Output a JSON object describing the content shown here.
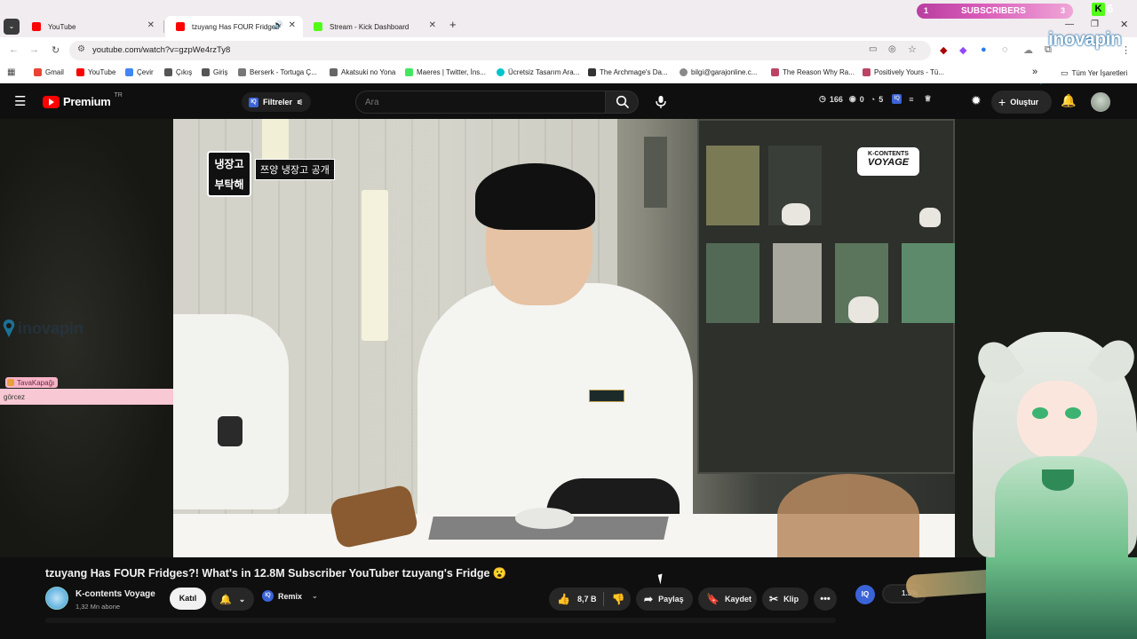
{
  "browser": {
    "tabs": [
      {
        "title": "YouTube",
        "active": false
      },
      {
        "title": "tzuyang Has FOUR Fridges?!",
        "active": true
      },
      {
        "title": "Stream - Kick Dashboard",
        "active": false
      }
    ],
    "new_tab": "+",
    "url": "youtube.com/watch?v=gzpWe4rzTy8",
    "bookmarks": [
      "Gmail",
      "YouTube",
      "Çevir",
      "Çıkış",
      "Giriş",
      "Berserk - Tortuga Ç...",
      "Akatsuki no Yona",
      "Maeres | Twitter, İns...",
      "Ücretsiz Tasarım Ara...",
      "The Archmage's Da...",
      "bilgi@garajonline.c...",
      "The Reason Why Ra...",
      "Positively Yours - Tü..."
    ],
    "all_bookmarks": "Tüm Yer İşaretleri",
    "more": "»"
  },
  "stream_overlay": {
    "subscribers_left": "1",
    "subscribers_label": "SUBSCRIBERS",
    "subscribers_right": "3",
    "kick_count": "6",
    "brand": "inovapin",
    "chat_user": "TavaKapağı",
    "chat_message": "görcez"
  },
  "youtube": {
    "logo_text": "Premium",
    "region": "TR",
    "filters_label": "Filtreler",
    "search_placeholder": "Ara",
    "stats": {
      "views": "166",
      "b": "0",
      "c": "5"
    },
    "create_label": "Oluştur"
  },
  "video_overlay": {
    "show_logo_line1": "냉장고",
    "show_logo_line2": "부탁해",
    "caption": "쯔양 냉장고 공개",
    "brand_line1": "K-CONTENTS",
    "brand_line2": "VOYAGE"
  },
  "video": {
    "title": "tzuyang Has FOUR Fridges?! What's in 12.8M Subscriber YouTuber tzuyang's Fridge 😮",
    "channel_name": "K-contents Voyage",
    "subscribers": "1,32 Mn abone",
    "join_label": "Katıl",
    "remix_label": "Remix",
    "likes": "8,7 B",
    "share_label": "Paylaş",
    "save_label": "Kaydet",
    "clip_label": "Klip",
    "extension_percent": "1.5%"
  },
  "colors": {
    "youtube_red": "#ff0000",
    "kick_green": "#53fc18",
    "chat_pink": "#f8c8d4"
  }
}
